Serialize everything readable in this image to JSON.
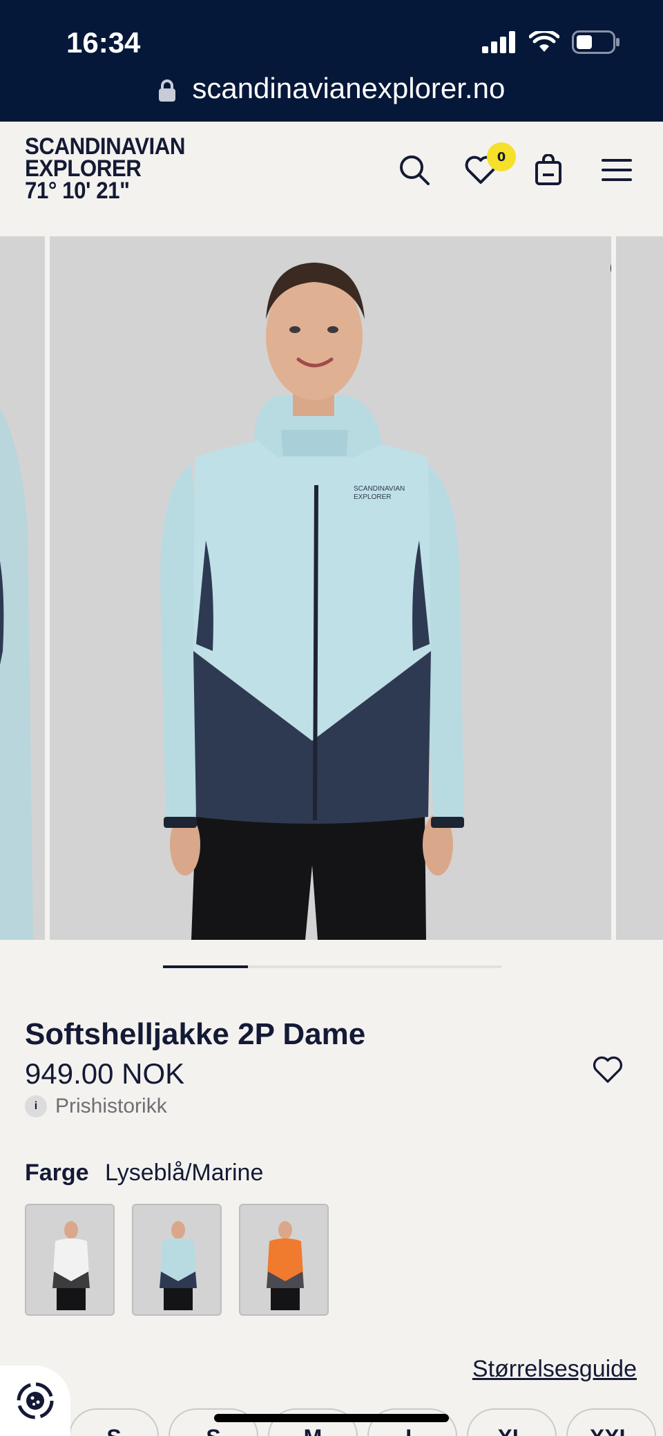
{
  "status_bar": {
    "time": "16:34",
    "battery_icon": "battery-icon",
    "wifi_icon": "wifi-icon",
    "signal_icon": "signal-icon"
  },
  "browser": {
    "url": "scandinavianexplorer.no"
  },
  "header": {
    "logo_lines": [
      "SCANDINAVIAN",
      "EXPLORER",
      "71° 10' 21\""
    ],
    "wishlist_count": "0"
  },
  "gallery": {
    "slide_count": 4,
    "active_index": 1,
    "progress_fraction": 0.25
  },
  "product": {
    "title": "Softshelljakke 2P Dame",
    "price": "949.00 NOK",
    "price_history_label": "Prishistorikk",
    "info_glyph": "i",
    "color_label": "Farge",
    "color_value": "Lyseblå/Marine",
    "swatches": [
      {
        "name": "Hvit/Grå",
        "top": "#f2f2f2",
        "bottom": "#3c3c3e"
      },
      {
        "name": "Lyseblå/Marine",
        "top": "#b8dbe2",
        "bottom": "#2e3a52"
      },
      {
        "name": "Oransje",
        "top": "#f07a2e",
        "bottom": "#4a4a52"
      }
    ],
    "size_guide_label": "Størrelsesguide",
    "sizes": [
      "S",
      "S",
      "M",
      "L",
      "XL",
      "XXL"
    ]
  },
  "colors": {
    "navy": "#061839",
    "badge": "#f5e02a",
    "background": "#f3f2ef",
    "slide_bg": "#d3d3d3"
  }
}
